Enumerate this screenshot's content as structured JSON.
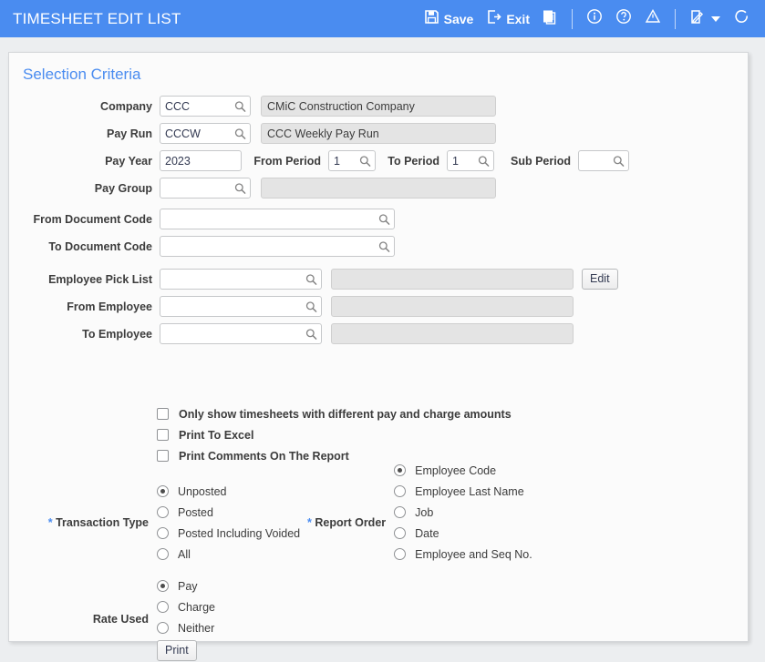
{
  "window": {
    "title": "TIMESHEET EDIT LIST",
    "header_color": "#4a8cf0",
    "accent_color": "#4a8cf0"
  },
  "toolbar": {
    "save_label": "Save",
    "exit_label": "Exit",
    "icons": [
      "save-icon",
      "exit-icon",
      "print-icon",
      "info-icon",
      "help-icon",
      "warning-icon",
      "notes-icon",
      "chevron-down-icon",
      "refresh-icon"
    ]
  },
  "panel": {
    "title": "Selection Criteria"
  },
  "fields": {
    "company": {
      "label": "Company",
      "value": "CCC",
      "description": "CMiC Construction Company"
    },
    "pay_run": {
      "label": "Pay Run",
      "value": "CCCW",
      "description": "CCC Weekly Pay Run"
    },
    "pay_year": {
      "label": "Pay Year",
      "value": "2023"
    },
    "from_period": {
      "label": "From Period",
      "value": "1"
    },
    "to_period": {
      "label": "To Period",
      "value": "1"
    },
    "sub_period": {
      "label": "Sub Period",
      "value": ""
    },
    "pay_group": {
      "label": "Pay Group",
      "value": "",
      "description": ""
    },
    "from_document_code": {
      "label": "From Document Code",
      "value": ""
    },
    "to_document_code": {
      "label": "To Document Code",
      "value": ""
    },
    "employee_pick_list": {
      "label": "Employee Pick List",
      "value": "",
      "description": "",
      "edit_label": "Edit"
    },
    "from_employee": {
      "label": "From Employee",
      "value": "",
      "description": ""
    },
    "to_employee": {
      "label": "To Employee",
      "value": "",
      "description": ""
    }
  },
  "checkboxes": [
    {
      "label": "Only show timesheets with different pay and charge amounts",
      "checked": false
    },
    {
      "label": "Print To Excel",
      "checked": false
    },
    {
      "label": "Print Comments On The Report",
      "checked": false
    }
  ],
  "transaction_type": {
    "label": "Transaction Type",
    "required": true,
    "selected": "Unposted",
    "options": [
      "Unposted",
      "Posted",
      "Posted Including Voided",
      "All"
    ]
  },
  "report_order": {
    "label": "Report Order",
    "required": true,
    "selected": "Employee Code",
    "options": [
      "Employee Code",
      "Employee Last Name",
      "Job",
      "Date",
      "Employee and Seq No."
    ]
  },
  "rate_used": {
    "label": "Rate Used",
    "required": false,
    "selected": "Pay",
    "options": [
      "Pay",
      "Charge",
      "Neither"
    ]
  },
  "actions": {
    "print_label": "Print"
  }
}
